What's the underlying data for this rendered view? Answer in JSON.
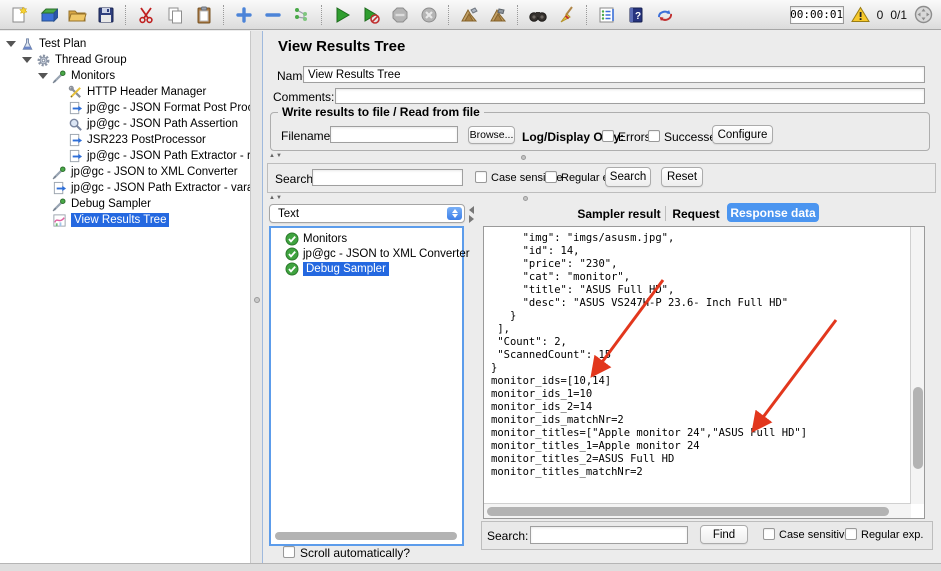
{
  "toolbar": {
    "icons": [
      "new-file",
      "templates",
      "open-file",
      "save",
      "cut",
      "copy",
      "paste",
      "expand-all",
      "collapse-all",
      "toggle",
      "start",
      "start-no-pauses",
      "stop",
      "shutdown",
      "remote-start-all",
      "remote-stop-all",
      "search",
      "clear-all",
      "function-helper",
      "help",
      "plugins-manager"
    ],
    "timer": "00:00:01",
    "warning_count": "0",
    "active_threads": "0/1"
  },
  "tree": {
    "items": [
      {
        "label": "Test Plan"
      },
      {
        "label": "Thread Group"
      },
      {
        "label": "Monitors"
      },
      {
        "label": "HTTP Header Manager"
      },
      {
        "label": "jp@gc - JSON Format Post Processo"
      },
      {
        "label": "jp@gc - JSON Path Assertion"
      },
      {
        "label": "JSR223 PostProcessor"
      },
      {
        "label": "jp@gc - JSON Path Extractor - resp"
      },
      {
        "label": "jp@gc - JSON to XML Converter"
      },
      {
        "label": "jp@gc - JSON Path Extractor - varaible"
      },
      {
        "label": "Debug Sampler"
      },
      {
        "label": "View Results Tree"
      }
    ]
  },
  "main": {
    "title": "View Results Tree",
    "name_label": "Name:",
    "name_value": "View Results Tree",
    "comments_label": "Comments:",
    "file_group": {
      "legend": "Write results to file / Read from file",
      "filename_label": "Filename",
      "filename_value": "",
      "browse_button": "Browse...",
      "log_display_label": "Log/Display Only:",
      "errors_label": "Errors",
      "successes_label": "Successes",
      "configure_button": "Configure"
    },
    "search_bar": {
      "label": "Search:",
      "value": "",
      "case_sensitive_label": "Case sensitive",
      "regex_label": "Regular exp.",
      "search_button": "Search",
      "reset_button": "Reset"
    },
    "results": {
      "view_mode": "Text",
      "items": [
        {
          "label": "Monitors"
        },
        {
          "label": "jp@gc - JSON to XML Converter"
        },
        {
          "label": "Debug Sampler"
        }
      ],
      "scroll_auto_label": "Scroll automatically?"
    },
    "tabs": {
      "items": [
        "Sampler result",
        "Request",
        "Response data"
      ],
      "selected": "Response data"
    },
    "response_text": "     \"img\": \"imgs/asusm.jpg\",\n     \"id\": 14,\n     \"price\": \"230\",\n     \"cat\": \"monitor\",\n     \"title\": \"ASUS Full HD\",\n     \"desc\": \"ASUS VS247H-P 23.6- Inch Full HD\"\n   }\n ],\n \"Count\": 2,\n \"ScannedCount\": 15\n}\nmonitor_ids=[10,14]\nmonitor_ids_1=10\nmonitor_ids_2=14\nmonitor_ids_matchNr=2\nmonitor_titles=[\"Apple monitor 24\",\"ASUS Full HD\"]\nmonitor_titles_1=Apple monitor 24\nmonitor_titles_2=ASUS Full HD\nmonitor_titles_matchNr=2",
    "find_bar": {
      "label": "Search:",
      "value": "",
      "find_button": "Find",
      "case_sensitive_label": "Case sensitive",
      "regex_label": "Regular exp."
    }
  },
  "colors": {
    "selection_blue": "#2468e0",
    "tab_blue": "#4b95f0",
    "arrow_red": "#e2371d",
    "check_green": "#3fa33f",
    "warning_yellow": "#f7c92c"
  }
}
